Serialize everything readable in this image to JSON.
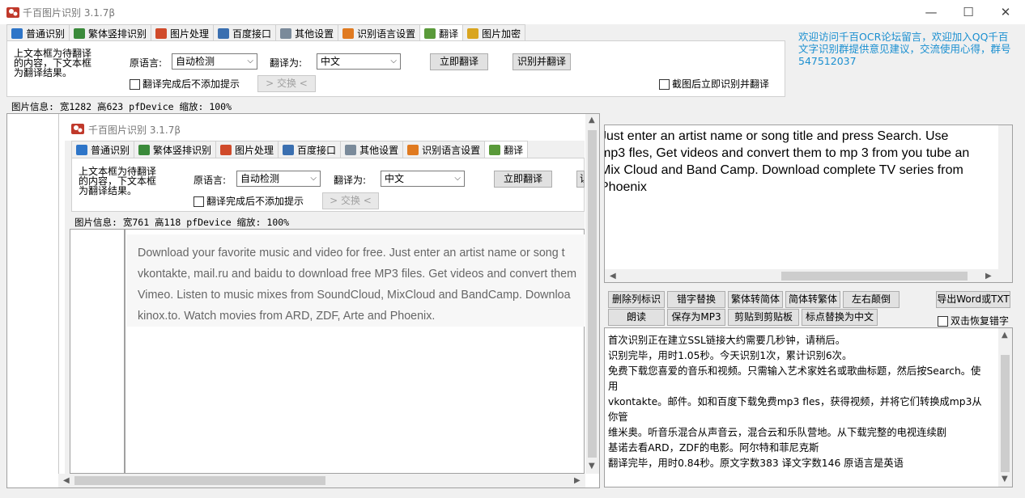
{
  "window": {
    "title": "千百图片识别 3.1.7β",
    "minimize": "—",
    "maximize": "☐",
    "close": "✕"
  },
  "tabs": [
    {
      "label": "普通识别",
      "color": "#2e75c8"
    },
    {
      "label": "繁体竖排识别",
      "color": "#3a8a3a"
    },
    {
      "label": "图片处理",
      "color": "#d04a2a"
    },
    {
      "label": "百度接口",
      "color": "#3a6fb0"
    },
    {
      "label": "其他设置",
      "color": "#7a8a9a"
    },
    {
      "label": "识别语言设置",
      "color": "#e07a20"
    },
    {
      "label": "翻译",
      "color": "#5a9a3a"
    },
    {
      "label": "图片加密",
      "color": "#d9a520"
    }
  ],
  "active_tab": 6,
  "translate_panel": {
    "hint": "上文本框为待翻译\n的内容，下文本框\n为翻译结果。",
    "source_label": "原语言:",
    "source_value": "自动检测",
    "target_label": "翻译为:",
    "target_value": "中文",
    "translate_button": "立即翻译",
    "ocr_translate_button": "识别并翻译",
    "no_prompt_label": "翻译完成后不添加提示",
    "swap_button": "> 交换 <",
    "auto_after_capture_label": "截图后立即识别并翻译"
  },
  "welcome": "欢迎访问千百OCR论坛留言，欢迎加入QQ千百文字识别群提供意见建议，交流使用心得，群号547512037",
  "image_info": "图片信息: 宽1282 高623 pfDevice 缩放: 100%",
  "nested": {
    "title": "千百图片识别 3.1.7β",
    "tabs": [
      "普通识别",
      "繁体竖排识别",
      "图片处理",
      "百度接口",
      "其他设置",
      "识别语言设置",
      "翻译"
    ],
    "hint": "上文本框为待翻译\n的内容，下文本框\n为翻译结果。",
    "source_label": "原语言:",
    "source_value": "自动检测",
    "target_label": "翻译为:",
    "target_value": "中文",
    "translate_button": "立即翻译",
    "cut_button": "识",
    "no_prompt_label": "翻译完成后不添加提示",
    "swap_button": "> 交换 <",
    "image_info": "图片信息: 宽761 高118 pfDevice 缩放: 100%",
    "image_text": [
      "Download your favorite music and video for free. Just enter an artist name or song t",
      "vkontakte, mail.ru and baidu to download free MP3 files. Get videos and convert them",
      "Vimeo. Listen to music mixes from SoundCloud, MixCloud and BandCamp. Downloa",
      "kinox.to. Watch movies from ARD, ZDF, Arte and Phoenix."
    ]
  },
  "source_text": [
    "Just enter an artist name or song title and press Search. Use",
    "mp3 fles, Get videos and convert them to mp 3 from you tube an",
    "Mix Cloud and Band Camp. Download complete TV series from",
    "Phoenix"
  ],
  "toolbar": {
    "row1": [
      "删除列标识",
      "错字替换",
      "繁体转简体",
      "简体转繁体",
      "左右颠倒"
    ],
    "export": "导出Word或TXT",
    "row2": [
      "朗读",
      "保存为MP3",
      "剪贴到剪贴板",
      "标点替换为中文"
    ],
    "restore_label": "双击恢复错字"
  },
  "result_text": [
    "首次识别正在建立SSL链接大约需要几秒钟，请稍后。",
    "识别完毕，用时1.05秒。今天识别1次，累计识别6次。",
    "免费下载您喜爱的音乐和视频。只需输入艺术家姓名或歌曲标题，然后按Search。使",
    "用",
    "vkontakte。邮件。如和百度下载免费mp3 fles，获得视频，并将它们转换成mp3从",
    "你管",
    "维米奥。听音乐混合从声音云，混合云和乐队营地。从下载完整的电视连续剧",
    "基诺去看ARD，ZDF的电影。阿尔特和菲尼克斯",
    "翻译完毕，用时0.84秒。原文字数383 译文字数146 原语言是英语"
  ]
}
